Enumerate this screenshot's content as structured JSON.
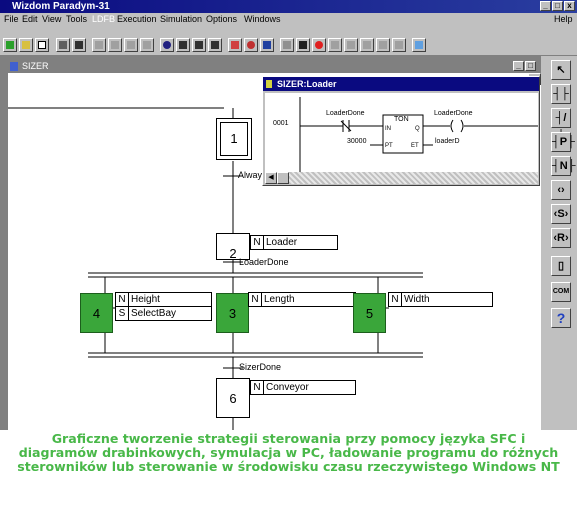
{
  "app": {
    "title": "Wizdom Paradym-31"
  },
  "menu": {
    "items": [
      "File",
      "Edit",
      "View",
      "Tools",
      "LDFB",
      "Execution",
      "Simulation",
      "Options",
      "Windows"
    ],
    "help": "Help"
  },
  "sizer": {
    "title": "SIZER"
  },
  "loader": {
    "title": "SIZER:Loader",
    "rung_number": "0001",
    "contact_label": "LoaderDone",
    "coil_label": "LoaderDone",
    "block": {
      "name": "TON",
      "in": "IN",
      "q": "Q",
      "pt": "PT",
      "et": "ET"
    },
    "preset_value": "30000",
    "et_var": "loaderD"
  },
  "sfc": {
    "steps": [
      {
        "num": "1"
      },
      {
        "num": "2",
        "qualifier": "N",
        "action": "Loader"
      },
      {
        "num": "3",
        "qualifier": "N",
        "action": "Length"
      },
      {
        "num": "4",
        "actions": [
          {
            "qualifier": "N",
            "name": "Height"
          },
          {
            "qualifier": "S",
            "name": "SelectBay"
          }
        ]
      },
      {
        "num": "5",
        "qualifier": "N",
        "action": "Width"
      },
      {
        "num": "6",
        "qualifier": "N",
        "action": "Conveyor"
      }
    ],
    "transitions": [
      "Always",
      "LoaderDone",
      "SizerDone"
    ]
  },
  "palette": {
    "items": [
      "↖",
      "┤├",
      "┤/├",
      "┤P├",
      "┤N├",
      "‹›",
      "‹S›",
      "‹R›",
      "▯",
      "COM",
      "?"
    ]
  },
  "caption": "Graficzne tworzenie strategii sterowania przy pomocy języka SFC i diagramów drabinkowych, symulacja w PC, ładowanie programu do różnych sterowników lub sterowanie w środowisku czasu rzeczywistego Windows NT",
  "colors": {
    "active_step": "#3aa63a",
    "caption_text": "#49b849",
    "title_bar": "#0a0a80",
    "window_chrome": "#c0c0c0"
  }
}
